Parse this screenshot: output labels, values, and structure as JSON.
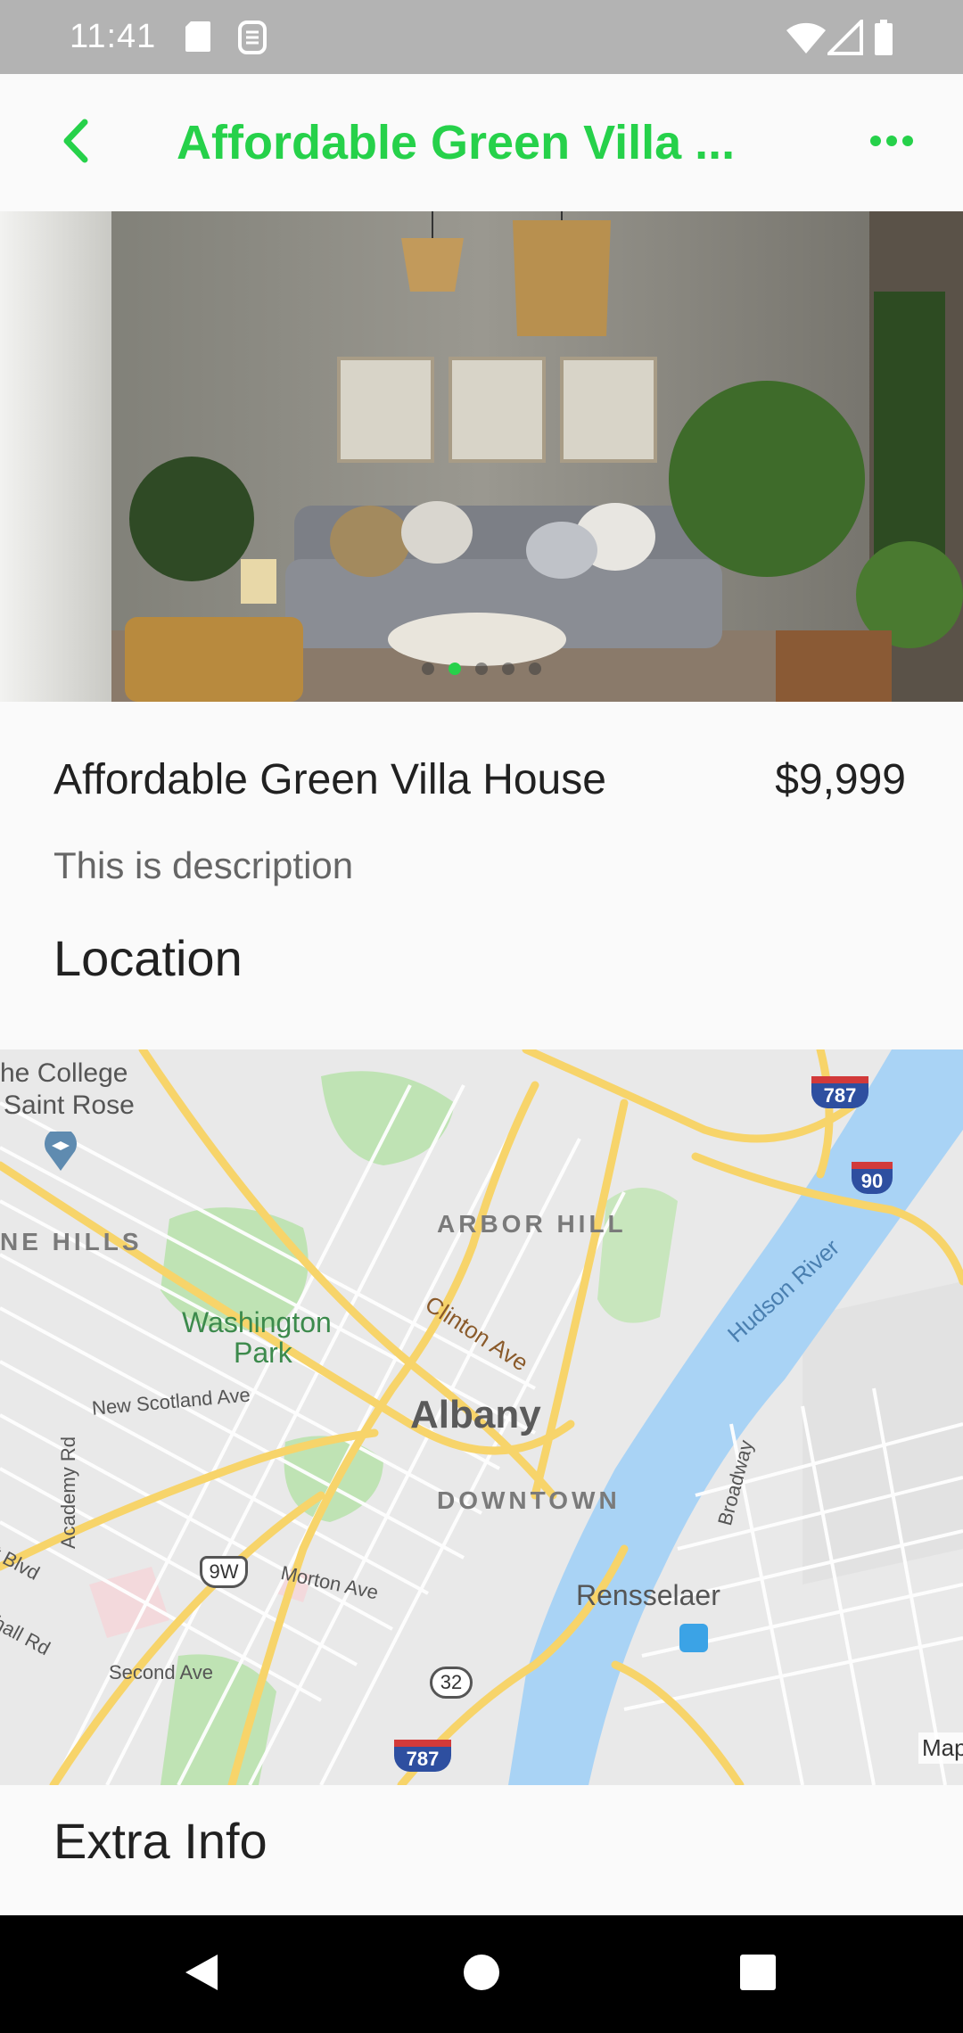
{
  "status_bar": {
    "time": "11:41",
    "icons": [
      "sd-card-icon",
      "sim-icon",
      "wifi-icon",
      "signal-icon",
      "battery-icon"
    ]
  },
  "app_bar": {
    "title": "Affordable Green Villa ...",
    "back_icon": "chevron-left-icon",
    "more_icon": "more-horizontal-icon",
    "accent_color": "#26d14a"
  },
  "gallery": {
    "image": "living-room-photo",
    "page_count": 5,
    "active_page": 2
  },
  "property": {
    "name": "Affordable Green Villa House",
    "price": "$9,999",
    "description": "This is description"
  },
  "sections": {
    "location": "Location",
    "extra_info": "Extra Info"
  },
  "map": {
    "labels": {
      "college": "he College",
      "saint_rose": "Saint Rose",
      "pine_hills": "NE HILLS",
      "arbor_hill": "ARBOR HILL",
      "clinton_ave": "Clinton Ave",
      "washington_park": "Washington",
      "park": "Park",
      "new_scotland": "New Scotland Ave",
      "albany": "Albany",
      "downtown": "DOWNTOWN",
      "academy_rd": "Academy Rd",
      "morton_ave": "Morton Ave",
      "hudson_river": "Hudson River",
      "broadway": "Broadway",
      "rensselaer": "Rensselaer",
      "second_ave": "Second Ave",
      "blvd": "t Blvd",
      "hall_rd": "hall Rd",
      "attribution": "Map"
    },
    "shields": {
      "i787_top": "787",
      "i90": "90",
      "us9w": "9W",
      "r32": "32",
      "i787_bottom": "787"
    }
  },
  "nav_bar": {
    "icons": [
      "back-triangle-icon",
      "home-circle-icon",
      "recents-square-icon"
    ]
  }
}
